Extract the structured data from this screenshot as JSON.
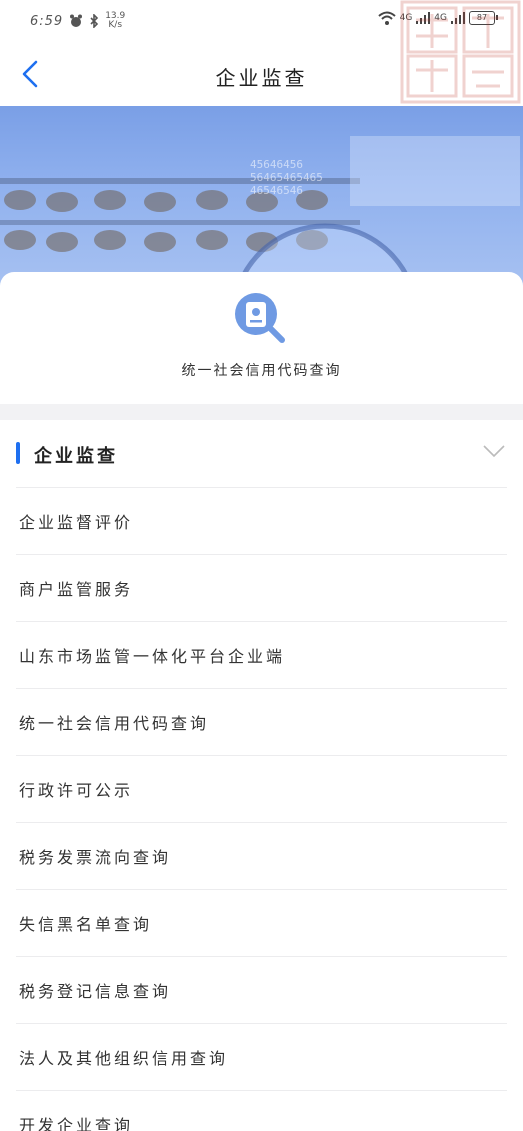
{
  "status": {
    "time": "6:59",
    "speed_value": "13.9",
    "speed_unit": "K/s",
    "signal1": "4G",
    "signal2": "4G",
    "battery": "87"
  },
  "nav": {
    "title": "企业监查"
  },
  "banner": {
    "digits": [
      "45646456",
      "56465465465",
      "46546546"
    ]
  },
  "query": {
    "label": "统一社会信用代码查询"
  },
  "section": {
    "title": "企业监查"
  },
  "menu": [
    "企业监督评价",
    "商户监管服务",
    "山东市场监管一体化平台企业端",
    "统一社会信用代码查询",
    "行政许可公示",
    "税务发票流向查询",
    "失信黑名单查询",
    "税务登记信息查询",
    "法人及其他组织信用查询",
    "开发企业查询"
  ],
  "colors": {
    "accent": "#1e6ff0",
    "banner": "#8fb0ee",
    "icon_bg": "#6f9ae3"
  },
  "icons": [
    "back-arrow-icon",
    "search-document-icon",
    "chevron-down-icon",
    "wifi-icon",
    "alarm-icon",
    "bluetooth-icon"
  ]
}
